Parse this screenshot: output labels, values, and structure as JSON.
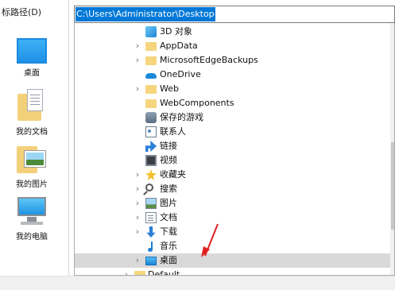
{
  "header": {
    "path_label": "标路径(D)",
    "address": "C:\\Users\\Administrator\\Desktop"
  },
  "sidebar": {
    "shortcuts": [
      {
        "label": "桌面",
        "icon": "desktop-icon"
      },
      {
        "label": "我的文档",
        "icon": "documents-icon"
      },
      {
        "label": "我的图片",
        "icon": "pictures-icon"
      },
      {
        "label": "我的电脑",
        "icon": "computer-icon"
      }
    ]
  },
  "tree": {
    "items": [
      {
        "label": "3D 对象",
        "icon": "3d-objects-icon",
        "expandable": false
      },
      {
        "label": "AppData",
        "icon": "folder-icon",
        "expandable": true
      },
      {
        "label": "MicrosoftEdgeBackups",
        "icon": "folder-icon",
        "expandable": true
      },
      {
        "label": "OneDrive",
        "icon": "onedrive-icon",
        "expandable": false
      },
      {
        "label": "Web",
        "icon": "folder-icon",
        "expandable": true
      },
      {
        "label": "WebComponents",
        "icon": "folder-icon",
        "expandable": false
      },
      {
        "label": "保存的游戏",
        "icon": "saved-games-icon",
        "expandable": false
      },
      {
        "label": "联系人",
        "icon": "contacts-icon",
        "expandable": false
      },
      {
        "label": "链接",
        "icon": "links-icon",
        "expandable": false
      },
      {
        "label": "视频",
        "icon": "video-icon",
        "expandable": false
      },
      {
        "label": "收藏夹",
        "icon": "favorites-icon",
        "expandable": true
      },
      {
        "label": "搜索",
        "icon": "search-icon",
        "expandable": true
      },
      {
        "label": "图片",
        "icon": "pictures-icon",
        "expandable": true
      },
      {
        "label": "文档",
        "icon": "documents-icon",
        "expandable": true
      },
      {
        "label": "下载",
        "icon": "downloads-icon",
        "expandable": true
      },
      {
        "label": "音乐",
        "icon": "music-icon",
        "expandable": false
      },
      {
        "label": "桌面",
        "icon": "desktop-icon",
        "expandable": true,
        "selected": true
      },
      {
        "label": "Default",
        "icon": "folder-icon",
        "expandable": true
      }
    ]
  },
  "colors": {
    "selection_blue": "#0078d7",
    "selected_row": "#d9d9d9",
    "annotation_arrow": "#e02020"
  }
}
